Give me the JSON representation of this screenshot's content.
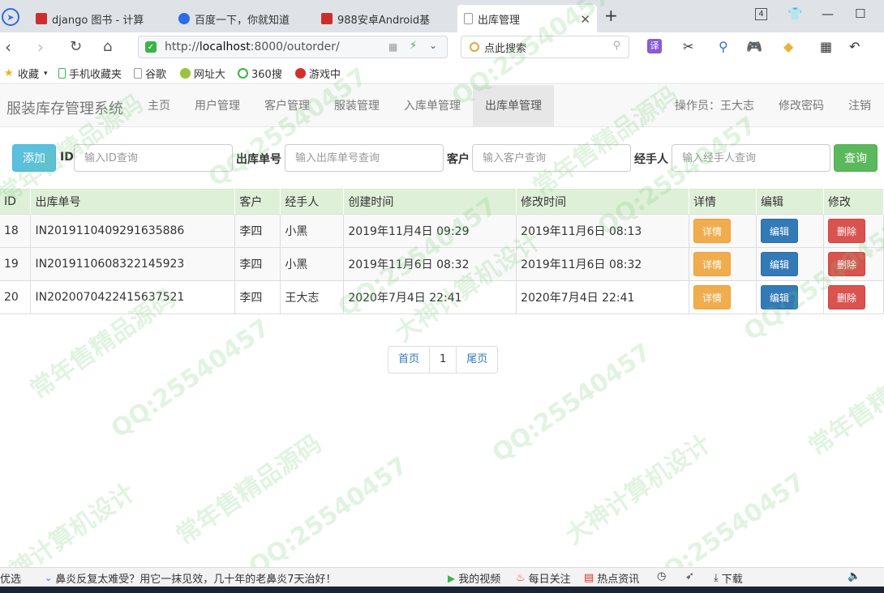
{
  "browser": {
    "tabs": [
      {
        "title": "django 图书 - 计算",
        "favicon_color": "#c9302c"
      },
      {
        "title": "百度一下，你就知道",
        "favicon_color": "#2e6be6"
      },
      {
        "title": "988安卓Android基",
        "favicon_color": "#c9302c"
      },
      {
        "title": "出库管理",
        "favicon_color": "#ffffff"
      }
    ],
    "tab_count": "4",
    "url_prefix": "http://",
    "url_host": "localhost",
    "url_path": ":8000/outorder/",
    "search_placeholder": "点此搜索",
    "bookmarks": [
      "收藏",
      "手机收藏夹",
      "谷歌",
      "网址大",
      "360搜",
      "游戏中"
    ]
  },
  "app": {
    "brand": "服装库存管理系统",
    "nav": [
      "主页",
      "用户管理",
      "客户管理",
      "服装管理",
      "入库单管理",
      "出库单管理"
    ],
    "active_nav": "出库单管理",
    "operator": "操作员：王大志",
    "change_password": "修改密码",
    "logout": "注销"
  },
  "search": {
    "add_label": "添加",
    "id_label": "ID",
    "id_placeholder": "输入ID查询",
    "order_label": "出库单号",
    "order_placeholder": "输入出库单号查询",
    "customer_label": "客户",
    "customer_placeholder": "输入客户查询",
    "handler_label": "经手人",
    "handler_placeholder": "输入经手人查询",
    "query_label": "查询",
    "colors": {
      "add": "#5bc0de",
      "query": "#5cb85c"
    }
  },
  "table": {
    "columns": [
      "ID",
      "出库单号",
      "客户",
      "经手人",
      "创建时间",
      "修改时间",
      "详情",
      "编辑",
      "修改"
    ],
    "rows": [
      {
        "id": "18",
        "order_no": "IN2019110409291635886",
        "customer": "李四",
        "handler": "小黑",
        "created": "2019年11月4日 09:29",
        "modified": "2019年11月6日 08:13"
      },
      {
        "id": "19",
        "order_no": "IN2019110608322145923",
        "customer": "李四",
        "handler": "小黑",
        "created": "2019年11月6日 08:32",
        "modified": "2019年11月6日 08:32"
      },
      {
        "id": "20",
        "order_no": "IN2020070422415637521",
        "customer": "李四",
        "handler": "王大志",
        "created": "2020年7月4日 22:41",
        "modified": "2020年7月4日 22:41"
      }
    ],
    "detail_label": "详情",
    "edit_label": "编辑",
    "delete_label": "删除"
  },
  "pagination": {
    "first": "首页",
    "page": "1",
    "last": "尾页"
  },
  "statusbar": {
    "left": "优选",
    "ad": "鼻炎反复太难受？用它一抹见效，几十年的老鼻炎7天治好！",
    "video": "我的视频",
    "follow": "每日关注",
    "news": "热点资讯",
    "download": "下载"
  },
  "watermark": {
    "text": "QQ:25540457",
    "text2": "常年售精品源码",
    "text3": "大神计算机设计"
  }
}
